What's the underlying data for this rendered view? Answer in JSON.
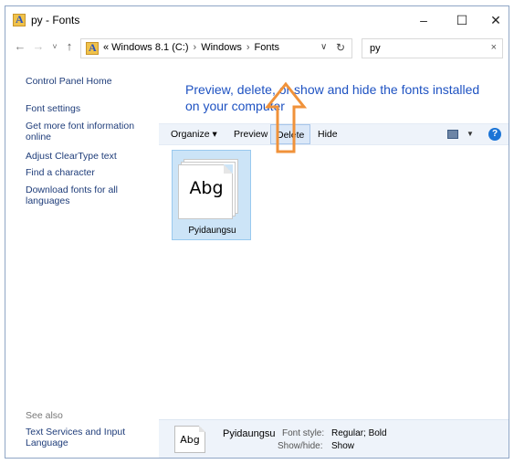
{
  "window": {
    "title": "py - Fonts",
    "minimize_label": "–",
    "maximize_label": "☐",
    "close_label": "✕"
  },
  "nav": {
    "back": "←",
    "forward": "→",
    "history": "˅",
    "up": "↑",
    "breadcrumb": [
      "« Windows 8.1 (C:)",
      "Windows",
      "Fonts"
    ],
    "separator": "›",
    "dropdown": "∨",
    "refresh": "↻"
  },
  "search": {
    "value": "py",
    "clear_label": "×"
  },
  "sidebar": {
    "links": [
      "Control Panel Home",
      "Font settings",
      "Get more font information online",
      "Adjust ClearType text",
      "Find a character",
      "Download fonts for all languages"
    ],
    "see_also_label": "See also",
    "see_also_links": [
      "Text Services and Input Language"
    ]
  },
  "main": {
    "heading": "Preview, delete, or show and hide the fonts installed on your computer"
  },
  "toolbar": {
    "organize": "Organize ▾",
    "preview": "Preview",
    "delete": "Delete",
    "hide": "Hide",
    "view_dropdown": "▼",
    "help": "?"
  },
  "files": [
    {
      "name": "Pyidaungsu",
      "sample": "Abg",
      "selected": true
    }
  ],
  "details": {
    "sample": "Abg",
    "name": "Pyidaungsu",
    "font_style_label": "Font style:",
    "font_style_value": "Regular; Bold",
    "show_hide_label": "Show/hide:",
    "show_hide_value": "Show"
  },
  "colors": {
    "link": "#1f3d7a",
    "heading": "#1e52c2",
    "selection": "#cce4f7",
    "annotation_arrow": "#f0923a"
  },
  "icons": {
    "folder": "fonts-folder-icon",
    "help": "help-icon",
    "view": "view-options-icon"
  }
}
